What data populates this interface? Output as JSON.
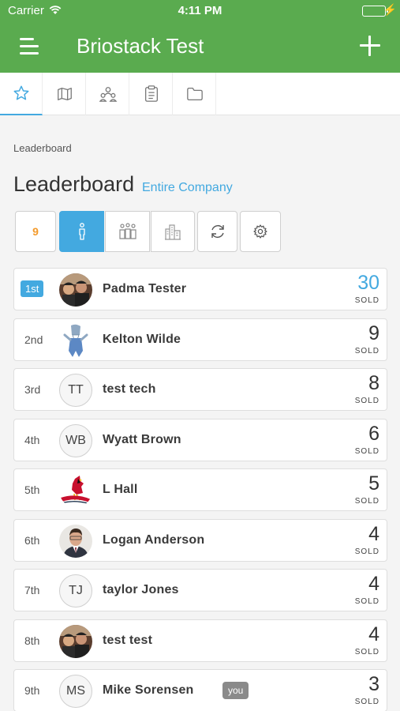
{
  "status_bar": {
    "carrier": "Carrier",
    "time": "4:11 PM"
  },
  "navbar": {
    "title": "Briostack Test"
  },
  "tabs": [
    {
      "icon": "star-icon",
      "active": true
    },
    {
      "icon": "map-icon",
      "active": false
    },
    {
      "icon": "team-icon",
      "active": false
    },
    {
      "icon": "clipboard-icon",
      "active": false
    },
    {
      "icon": "folder-icon",
      "active": false
    }
  ],
  "breadcrumb": "Leaderboard",
  "page_title": "Leaderboard",
  "scope_link": "Entire Company",
  "filters": {
    "count": "9",
    "items": [
      {
        "icon": "count-badge",
        "selected": false
      },
      {
        "icon": "individual-icon",
        "selected": true
      },
      {
        "icon": "group-icon",
        "selected": false
      },
      {
        "icon": "buildings-icon",
        "selected": false
      },
      {
        "icon": "refresh-icon",
        "selected": false
      },
      {
        "icon": "gear-icon",
        "selected": false
      }
    ]
  },
  "sold_label": "SOLD",
  "you_label": "you",
  "leaderboard": [
    {
      "rank": "1st",
      "name": "Padma Tester",
      "score": "30",
      "avatar": "photo"
    },
    {
      "rank": "2nd",
      "name": "Kelton Wilde",
      "score": "9",
      "avatar": "shark"
    },
    {
      "rank": "3rd",
      "name": "test tech",
      "score": "8",
      "initials": "TT"
    },
    {
      "rank": "4th",
      "name": "Wyatt Brown",
      "score": "6",
      "initials": "WB"
    },
    {
      "rank": "5th",
      "name": "L Hall",
      "score": "5",
      "avatar": "cardinal"
    },
    {
      "rank": "6th",
      "name": "Logan Anderson",
      "score": "4",
      "avatar": "man"
    },
    {
      "rank": "7th",
      "name": "taylor Jones",
      "score": "4",
      "initials": "TJ"
    },
    {
      "rank": "8th",
      "name": "test test",
      "score": "4",
      "avatar": "photo"
    },
    {
      "rank": "9th",
      "name": "Mike Sorensen",
      "score": "3",
      "initials": "MS",
      "is_you": true
    }
  ],
  "colors": {
    "header_green": "#5aab4f",
    "accent_blue": "#43a9e0",
    "count_orange": "#f39a2b"
  }
}
